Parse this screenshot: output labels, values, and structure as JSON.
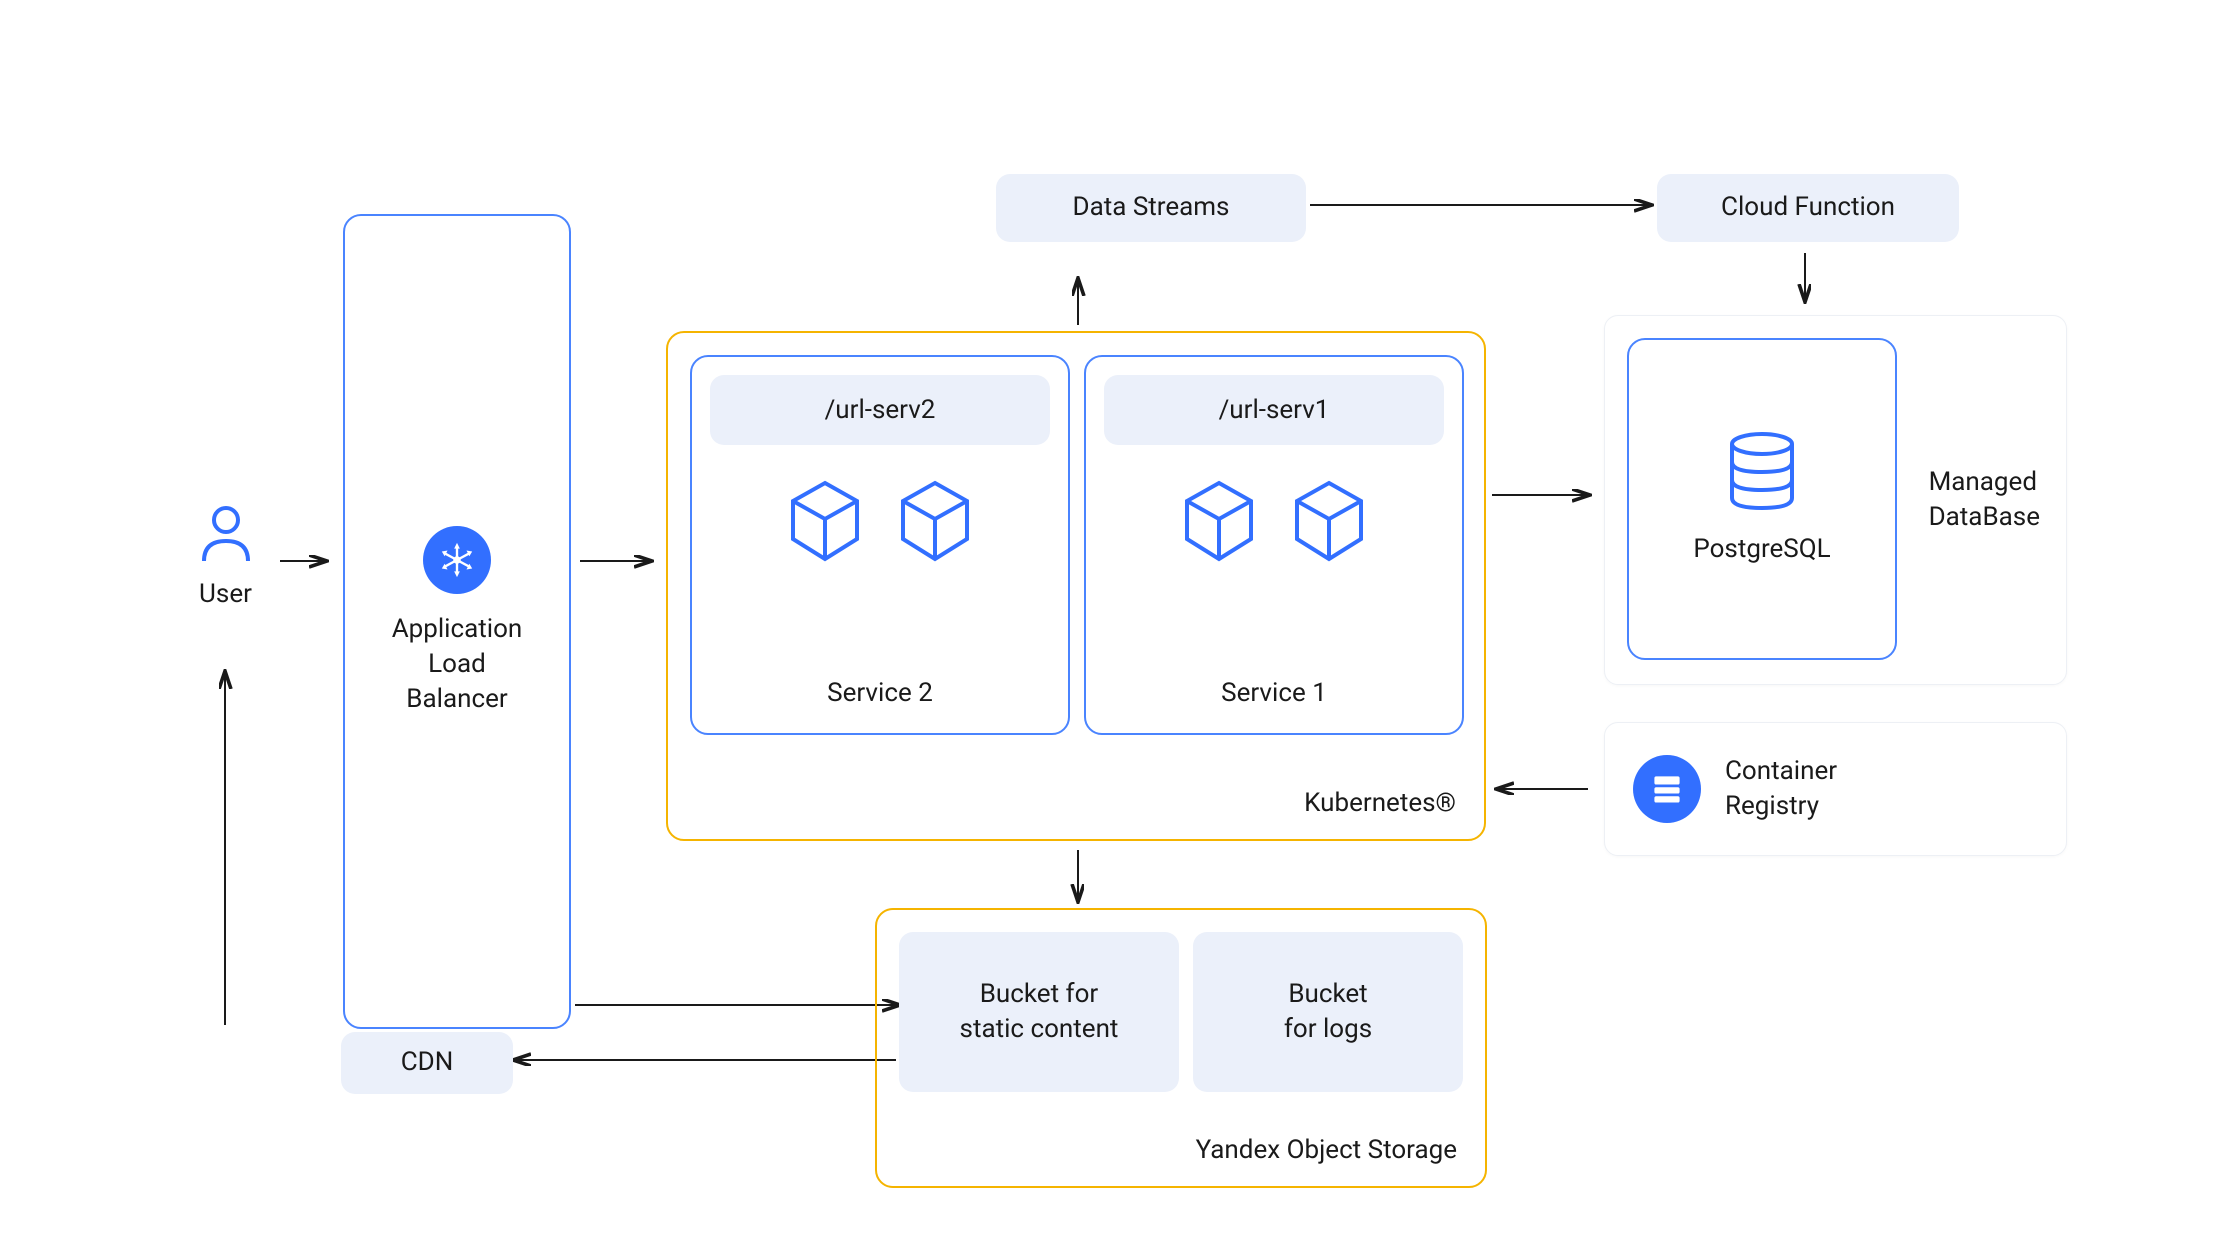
{
  "user_label": "User",
  "alb_label": "Application\nLoad\nBalancer",
  "cdn_label": "CDN",
  "data_streams_label": "Data Streams",
  "cloud_function_label": "Cloud Function",
  "kubernetes_label": "Kubernetes®",
  "service2": {
    "url": "/url-serv2",
    "name": "Service 2"
  },
  "service1": {
    "url": "/url-serv1",
    "name": "Service 1"
  },
  "object_storage_label": "Yandex Object Storage",
  "bucket_static": "Bucket for\nstatic content",
  "bucket_logs": "Bucket\nfor logs",
  "postgresql_label": "PostgreSQL",
  "managed_db_label": "Managed\nDataBase",
  "container_registry_label": "Container\nRegistry",
  "colors": {
    "blue": "#326fff",
    "blue_border": "#4a84ff",
    "orange": "#f5b400",
    "lightblue": "#ebf0fa"
  }
}
